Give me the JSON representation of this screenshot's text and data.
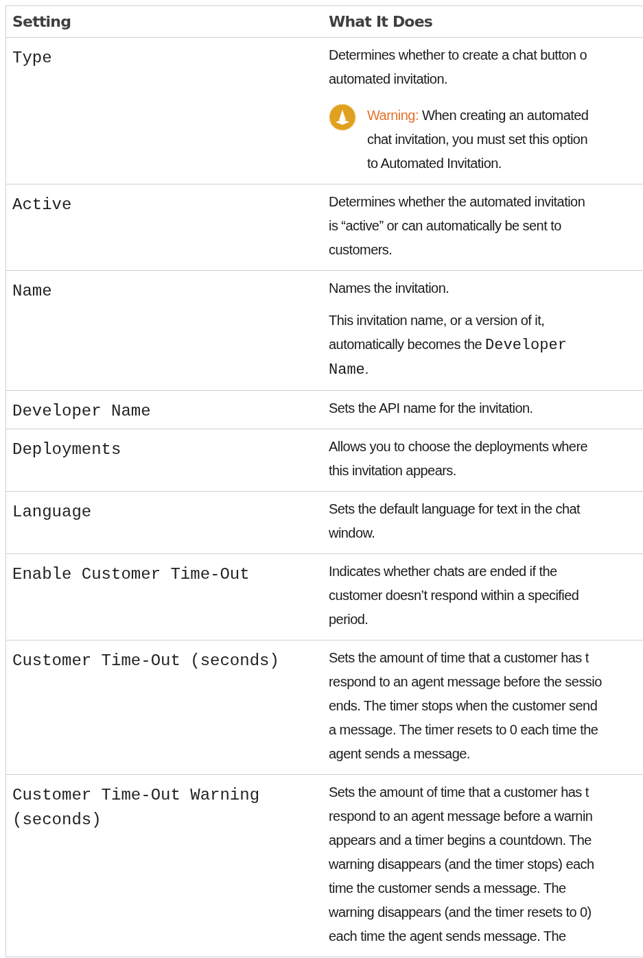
{
  "table": {
    "columns": [
      "Setting",
      "What It Does"
    ],
    "rows": [
      {
        "setting": [
          "Type"
        ],
        "paragraphs": [
          {
            "kind": "text",
            "lines": [
              "Determines whether to create a chat button o",
              "automated invitation."
            ]
          },
          {
            "kind": "warning",
            "label": "Warning:",
            "lines": [
              "When creating an automated",
              "chat invitation, you must set this option",
              "to Automated Invitation."
            ]
          }
        ]
      },
      {
        "setting": [
          "Active"
        ],
        "paragraphs": [
          {
            "kind": "text",
            "lines": [
              "Determines whether the automated invitation",
              "is “active” or can automatically be sent to",
              "customers."
            ]
          }
        ]
      },
      {
        "setting": [
          "Name"
        ],
        "paragraphs": [
          {
            "kind": "text",
            "lines": [
              "Names the invitation."
            ]
          },
          {
            "kind": "text",
            "lines": [
              "This invitation name, or a version of it,",
              [
                {
                  "text": "automatically becomes the ",
                  "code": false
                },
                {
                  "text": "Developer",
                  "code": true
                }
              ],
              [
                {
                  "text": "Name",
                  "code": true
                },
                {
                  "text": ".",
                  "code": false
                }
              ]
            ]
          }
        ]
      },
      {
        "setting": [
          "Developer Name"
        ],
        "paragraphs": [
          {
            "kind": "text",
            "lines": [
              "Sets the API name for the invitation."
            ]
          }
        ]
      },
      {
        "setting": [
          "Deployments"
        ],
        "paragraphs": [
          {
            "kind": "text",
            "lines": [
              "Allows you to choose the deployments where",
              "this invitation appears."
            ]
          }
        ]
      },
      {
        "setting": [
          "Language"
        ],
        "paragraphs": [
          {
            "kind": "text",
            "lines": [
              "Sets the default language for text in the chat",
              "window."
            ]
          }
        ]
      },
      {
        "setting": [
          "Enable Customer Time-Out"
        ],
        "paragraphs": [
          {
            "kind": "text",
            "lines": [
              "Indicates whether chats are ended if the",
              "customer doesn’t respond within a specified",
              "period."
            ]
          }
        ]
      },
      {
        "setting": [
          "Customer Time-Out (seconds)"
        ],
        "paragraphs": [
          {
            "kind": "text",
            "lines": [
              "Sets the amount of time that a customer has t",
              "respond to an agent message before the sessio",
              "ends. The timer stops when the customer send",
              "a message. The timer resets to 0 each time the",
              "agent sends a message."
            ]
          }
        ]
      },
      {
        "setting": [
          "Customer Time-Out Warning",
          "(seconds)"
        ],
        "paragraphs": [
          {
            "kind": "text",
            "lines": [
              "Sets the amount of time that a customer has t",
              "respond to an agent message before a warnin",
              "appears and a timer begins a countdown. The",
              "warning disappears (and the timer stops) each",
              "time the customer sends a message. The",
              "warning disappears (and the timer resets to 0)",
              "each time the agent sends message. The"
            ]
          }
        ]
      }
    ]
  }
}
